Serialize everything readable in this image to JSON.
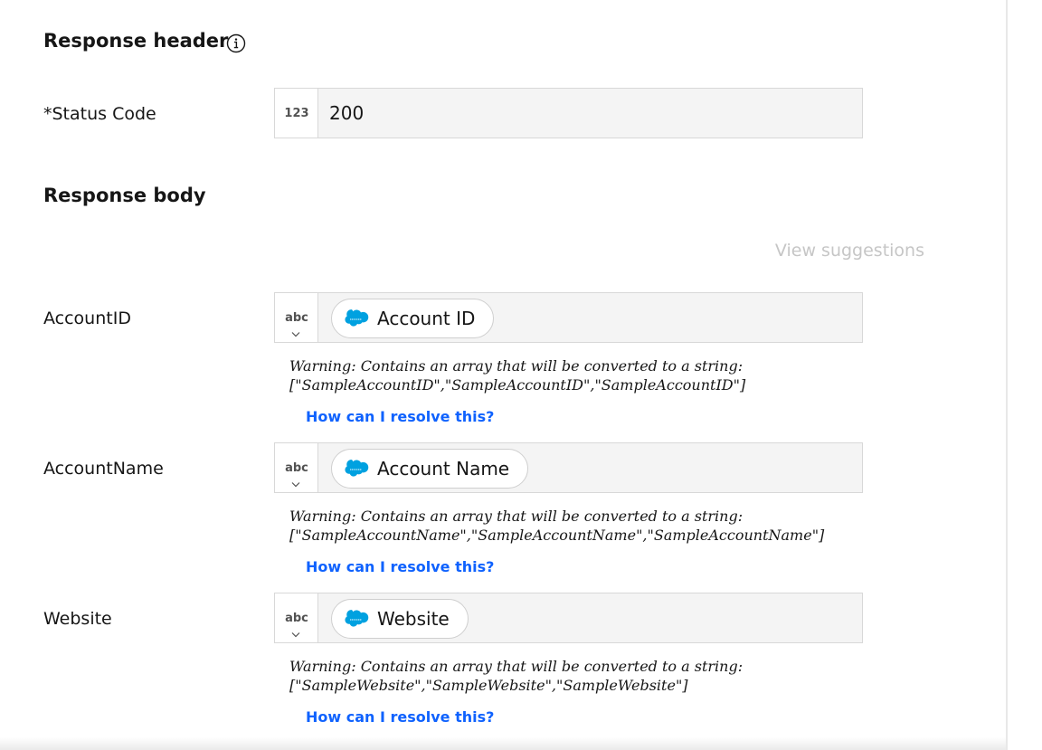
{
  "response_header": {
    "title": "Response header",
    "status_code": {
      "label": "*Status Code",
      "type": "123",
      "value": "200"
    }
  },
  "response_body": {
    "title": "Response body",
    "view_suggestions": "View suggestions",
    "fields": [
      {
        "label": "AccountID",
        "type": "abc",
        "value": "Account ID",
        "warning_line1": "Warning: Contains an array that will be converted to a string:",
        "warning_line2": "[\"SampleAccountID\",\"SampleAccountID\",\"SampleAccountID\"]",
        "link": "How can I resolve this?"
      },
      {
        "label": "AccountName",
        "type": "abc",
        "value": "Account Name",
        "warning_line1": "Warning: Contains an array that will be converted to a string:",
        "warning_line2": "[\"SampleAccountName\",\"SampleAccountName\",\"SampleAccountName\"]",
        "link": "How can I resolve this?"
      },
      {
        "label": "Website",
        "type": "abc",
        "value": "Website",
        "warning_line1": "Warning: Contains an array that will be converted to a string:",
        "warning_line2": "[\"SampleWebsite\",\"SampleWebsite\",\"SampleWebsite\"]",
        "link": "How can I resolve this?"
      }
    ]
  },
  "icons": {
    "info": "info-icon",
    "source_logo": "salesforce-logo-icon",
    "dropdown": "chevron-down-icon"
  },
  "colors": {
    "link": "#0f62fe",
    "field_bg": "#f4f4f4",
    "border": "#d8d8d8",
    "muted": "#c6c6c6",
    "logo": "#00a1e0"
  }
}
